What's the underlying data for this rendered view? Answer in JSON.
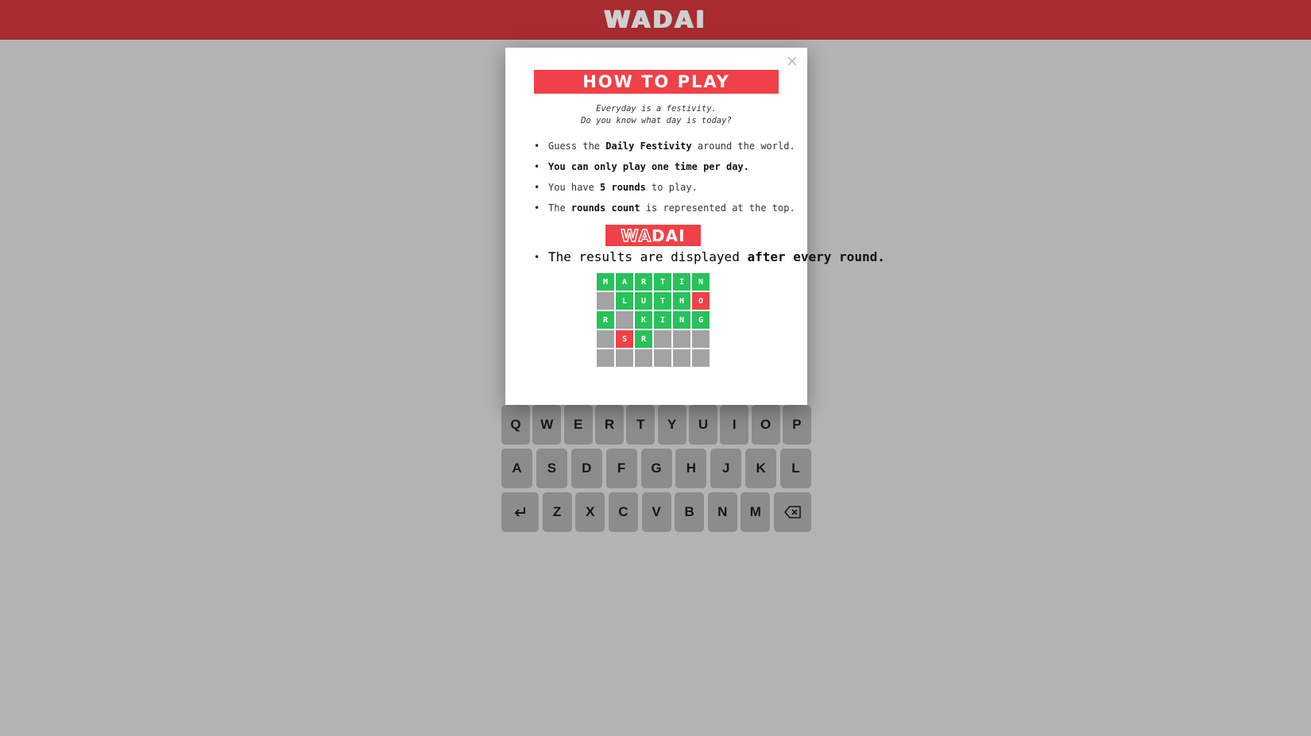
{
  "header": {
    "logo_text": "WADAI"
  },
  "keyboard": {
    "rows": [
      [
        "Q",
        "W",
        "E",
        "R",
        "T",
        "Y",
        "U",
        "I",
        "O",
        "P"
      ],
      [
        "A",
        "S",
        "D",
        "F",
        "G",
        "H",
        "J",
        "K",
        "L"
      ],
      [
        "Z",
        "X",
        "C",
        "V",
        "B",
        "N",
        "M"
      ]
    ],
    "enter_icon": "enter-icon",
    "backspace_icon": "backspace-icon"
  },
  "modal": {
    "close_icon": "close-icon",
    "title": "HOW TO PLAY",
    "tagline_1": "Everyday is a festivity.",
    "tagline_2": "Do you know what day is today?",
    "rules": [
      {
        "parts": [
          {
            "t": "Guess the "
          },
          {
            "t": "Daily Festivity",
            "b": true
          },
          {
            "t": " around the world."
          }
        ]
      },
      {
        "parts": [
          {
            "t": "You can only play one time per day.",
            "b": true
          }
        ]
      },
      {
        "parts": [
          {
            "t": "You have "
          },
          {
            "t": "5 rounds",
            "b": true
          },
          {
            "t": " to play."
          }
        ]
      },
      {
        "parts": [
          {
            "t": "The "
          },
          {
            "t": "rounds count",
            "b": true
          },
          {
            "t": " is represented at the top."
          }
        ]
      }
    ],
    "mini_logo": {
      "outlined": "WA",
      "filled": "DAI"
    },
    "last_rule": {
      "parts": [
        {
          "t": "The results are displayed "
        },
        {
          "t": "after every round.",
          "b": true
        }
      ]
    },
    "example_grid": [
      [
        {
          "l": "M",
          "s": "correct"
        },
        {
          "l": "A",
          "s": "correct"
        },
        {
          "l": "R",
          "s": "correct"
        },
        {
          "l": "T",
          "s": "correct"
        },
        {
          "l": "I",
          "s": "correct"
        },
        {
          "l": "N",
          "s": "correct"
        }
      ],
      [
        {
          "l": "",
          "s": "empty"
        },
        {
          "l": "L",
          "s": "correct"
        },
        {
          "l": "U",
          "s": "correct"
        },
        {
          "l": "T",
          "s": "correct"
        },
        {
          "l": "H",
          "s": "correct"
        },
        {
          "l": "O",
          "s": "wrong"
        }
      ],
      [
        {
          "l": "R",
          "s": "correct"
        },
        {
          "l": "",
          "s": "empty"
        },
        {
          "l": "K",
          "s": "correct"
        },
        {
          "l": "I",
          "s": "correct"
        },
        {
          "l": "N",
          "s": "correct"
        },
        {
          "l": "G",
          "s": "correct"
        }
      ],
      [
        {
          "l": "",
          "s": "empty"
        },
        {
          "l": "S",
          "s": "wrong"
        },
        {
          "l": "R",
          "s": "correct"
        },
        {
          "l": "",
          "s": "empty"
        },
        {
          "l": "",
          "s": "empty"
        },
        {
          "l": "",
          "s": "empty"
        }
      ],
      [
        {
          "l": "",
          "s": "empty"
        },
        {
          "l": "",
          "s": "empty"
        },
        {
          "l": "",
          "s": "empty"
        },
        {
          "l": "",
          "s": "empty"
        },
        {
          "l": "",
          "s": "empty"
        },
        {
          "l": "",
          "s": "empty"
        }
      ]
    ]
  },
  "colors": {
    "header_bg": "#a62c30",
    "accent_red": "#ef4147",
    "correct_green": "#27c25a",
    "empty_gray": "#a3a3a3",
    "key_gray": "#8c8c8c",
    "page_bg": "#b3b3b3"
  }
}
